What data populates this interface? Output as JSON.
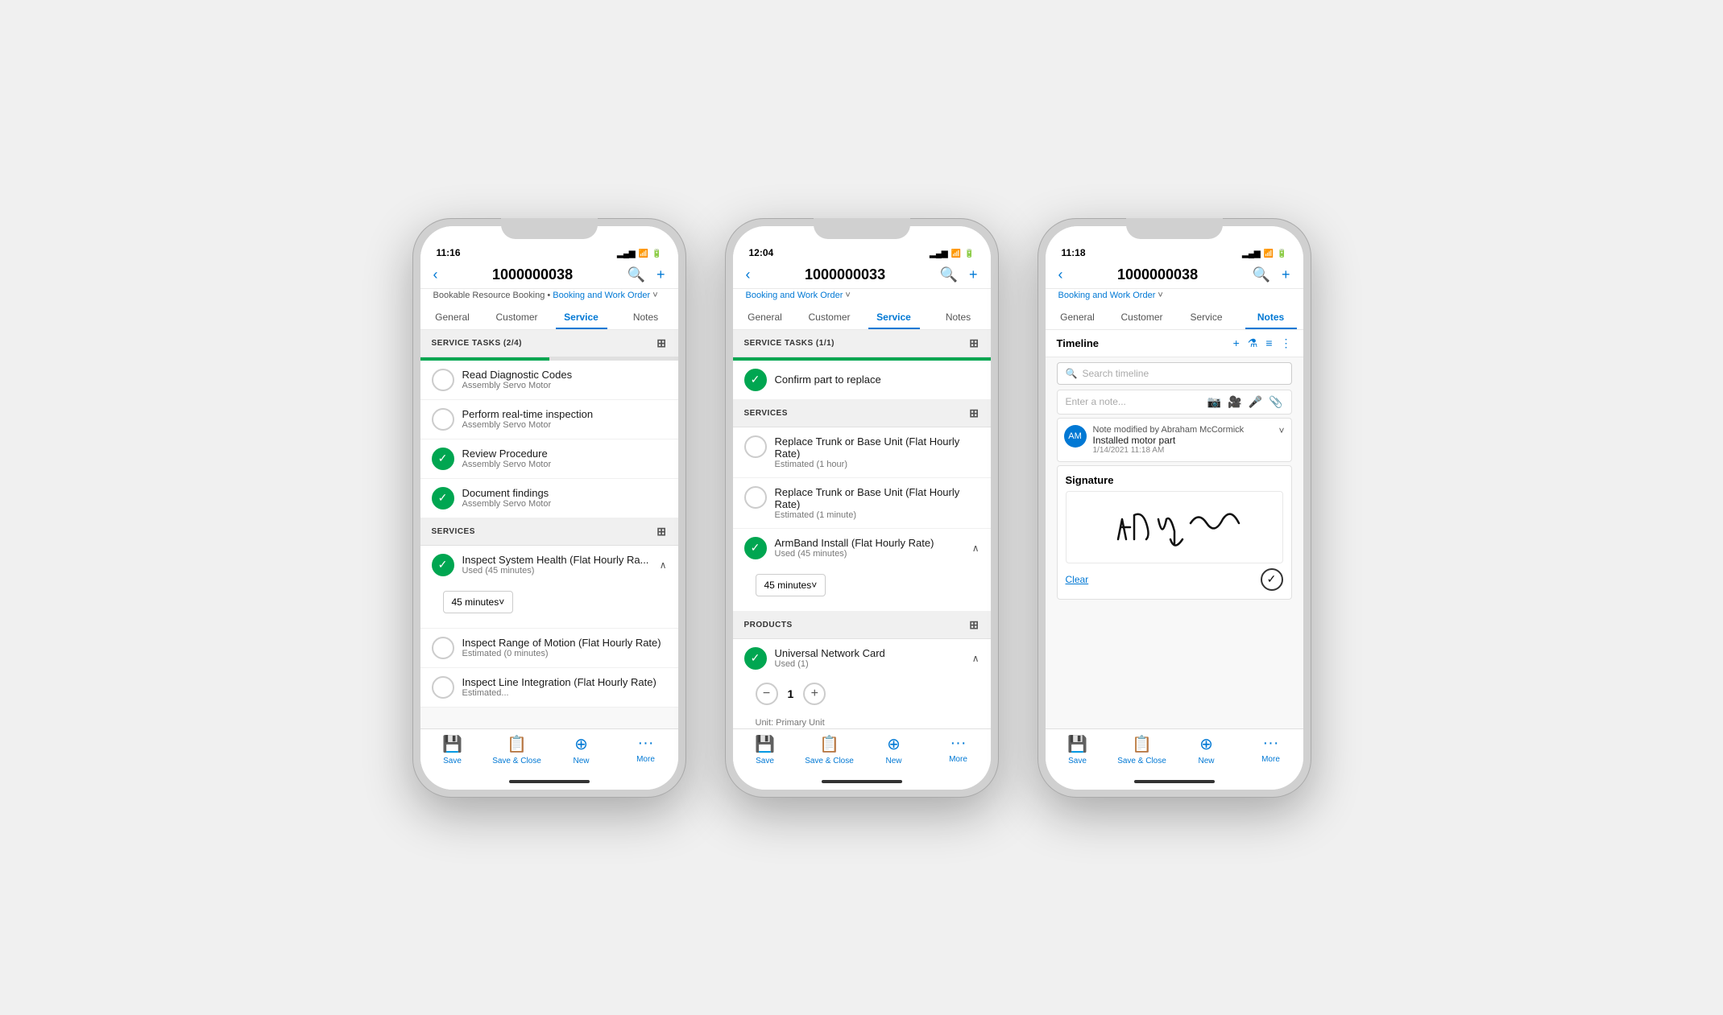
{
  "phones": [
    {
      "id": "phone1",
      "status": {
        "time": "11:16",
        "hasArrow": true
      },
      "header": {
        "title": "1000000038",
        "backVisible": true
      },
      "subtitle": "Bookable Resource Booking  •",
      "subtitle2": "Booking and Work Order",
      "tabs": [
        "General",
        "Customer",
        "Service",
        "Notes"
      ],
      "activeTab": "Service",
      "sections": [
        {
          "type": "tasks",
          "label": "SERVICE TASKS (2/4)",
          "progressFill": "50%",
          "items": [
            {
              "name": "Read Diagnostic Codes",
              "sub": "Assembly Servo Motor",
              "completed": false
            },
            {
              "name": "Perform real-time inspection",
              "sub": "Assembly Servo Motor",
              "completed": false
            },
            {
              "name": "Review Procedure",
              "sub": "Assembly Servo Motor",
              "completed": true
            },
            {
              "name": "Document findings",
              "sub": "Assembly Servo Motor",
              "completed": true
            }
          ]
        },
        {
          "type": "services",
          "label": "SERVICES",
          "items": [
            {
              "name": "Inspect System Health (Flat Hourly Ra...",
              "sub": "Used (45 minutes)",
              "completed": true,
              "expanded": true,
              "dropdownValue": "45 minutes"
            },
            {
              "name": "Inspect Range of Motion (Flat Hourly Rate)",
              "sub": "Estimated (0 minutes)",
              "completed": false,
              "expanded": false
            },
            {
              "name": "Inspect Line Integration (Flat Hourly Rate)",
              "sub": "Estimated...",
              "completed": false,
              "expanded": false
            }
          ]
        }
      ],
      "toolbar": [
        "Save",
        "Save & Close",
        "New",
        "More"
      ]
    },
    {
      "id": "phone2",
      "status": {
        "time": "12:04",
        "hasArrow": true
      },
      "header": {
        "title": "1000000033",
        "backVisible": true
      },
      "subtitle2": "Booking and Work Order",
      "tabs": [
        "General",
        "Customer",
        "Service",
        "Notes"
      ],
      "activeTab": "Service",
      "sections": [
        {
          "type": "tasks",
          "label": "SERVICE TASKS (1/1)",
          "progressFill": "100%",
          "items": [
            {
              "name": "Confirm part to replace",
              "sub": "",
              "completed": true
            }
          ]
        },
        {
          "type": "services",
          "label": "SERVICES",
          "items": [
            {
              "name": "Replace Trunk or Base Unit (Flat Hourly Rate)",
              "sub": "Estimated (1 hour)",
              "completed": false,
              "expanded": false
            },
            {
              "name": "Replace Trunk or Base Unit (Flat Hourly Rate)",
              "sub": "Estimated (1 minute)",
              "completed": false,
              "expanded": false
            },
            {
              "name": "ArmBand Install (Flat Hourly Rate)",
              "sub": "Used (45 minutes)",
              "completed": true,
              "expanded": true,
              "dropdownValue": "45 minutes"
            }
          ]
        },
        {
          "type": "products",
          "label": "PRODUCTS",
          "items": [
            {
              "name": "Universal Network Card",
              "sub": "Used (1)",
              "completed": true,
              "expanded": true,
              "quantity": "1",
              "unit": "Unit: Primary Unit"
            }
          ]
        }
      ],
      "toolbar": [
        "Save",
        "Save & Close",
        "New",
        "More"
      ]
    },
    {
      "id": "phone3",
      "status": {
        "time": "11:18",
        "hasArrow": true
      },
      "header": {
        "title": "1000000038",
        "backVisible": true
      },
      "subtitle2": "Booking and Work Order",
      "tabs": [
        "General",
        "Customer",
        "Service",
        "Notes"
      ],
      "activeTab": "Notes",
      "notesContent": {
        "timelineLabel": "Timeline",
        "searchPlaceholder": "Search timeline",
        "noteInputPlaceholder": "Enter a note...",
        "entry": {
          "author": "Note modified by Abraham McCormick",
          "content": "Installed motor part",
          "time": "1/14/2021 11:18 AM"
        },
        "signatureLabel": "Signature",
        "clearLabel": "Clear"
      },
      "toolbar": [
        "Save",
        "Save & Close",
        "New",
        "More"
      ]
    }
  ],
  "toolbar": {
    "save": "Save",
    "saveClose": "Save & Close",
    "new": "New",
    "more": "More"
  }
}
